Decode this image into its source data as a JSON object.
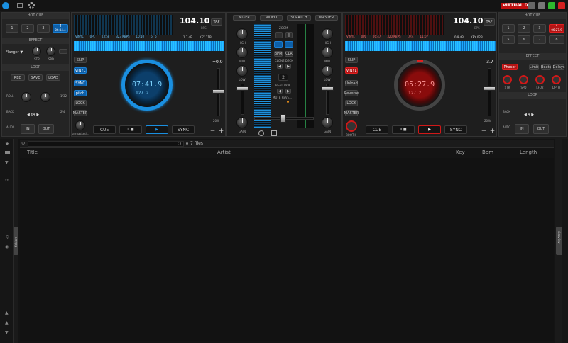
{
  "app": {
    "brand": "VIRTUAL DJ"
  },
  "left": {
    "hotcue_header": "HOT CUE",
    "hotcues": [
      "1",
      "2",
      "3",
      "4"
    ],
    "hotcue_time": "06:34.4",
    "effect_header": "EFFECT",
    "effect_name": "Flanger",
    "effect_knobs": [
      "STR",
      "SPD"
    ],
    "loop_header": "LOOP",
    "loop_buttons": [
      "RED",
      "SAVE",
      "LOAD"
    ],
    "loop_size": "64",
    "roll_label": "ROLL",
    "back_label": "BACK",
    "auto_label": "AUTO",
    "in_label": "IN",
    "out_label": "OUT",
    "side_small": [
      "1/32",
      "1/2",
      "2/4"
    ]
  },
  "deck1": {
    "bpm": "104.10",
    "bpm_unit": "BPS",
    "tap": "TAP",
    "gain_db": "1.7 dB",
    "key": "KEY 11B",
    "info_row": [
      "VINYL",
      "0PL",
      "03:58",
      "323 KBPS",
      "10:10",
      "6:_b"
    ],
    "side_buttons": [
      "SLIP",
      "VINYL",
      "SYNC",
      "pitch",
      "LOCK",
      "MASTER"
    ],
    "active_side": [
      "VINYL",
      "SYNC",
      "pitch"
    ],
    "platter_time": "07:41.9",
    "platter_sub": "127.2",
    "pitch_value": "+0.0",
    "pitch_range": "20%",
    "transport": [
      "CUE",
      "II ■",
      "▶",
      "SYNC"
    ],
    "minus": "−",
    "plus": "+",
    "encoder_label": "unmasked..."
  },
  "deck2": {
    "bpm": "104.10",
    "bpm_unit": "BPS",
    "tap": "TAP",
    "gain_db": "0.9 dB",
    "key": "KEY 02B",
    "info_row": [
      "VINYL",
      "0PL",
      "06:47",
      "320 KBPS",
      "10:4",
      "11:07"
    ],
    "side_buttons": [
      "SLIP",
      "VINYL",
      "Unload",
      "Reverse",
      "LOCK",
      "MASTER"
    ],
    "platter_time": "05:27.9",
    "platter_sub": "127.2",
    "pitch_value": "-3.7",
    "pitch_range": "20%",
    "transport": [
      "CUE",
      "II ■",
      "▶",
      "SYNC"
    ],
    "minus": "−",
    "plus": "+",
    "booth": "BOOTH"
  },
  "right": {
    "hotcue_header": "HOT CUE",
    "hotcues": [
      "1",
      "2",
      "3",
      "4",
      "5",
      "6",
      "7",
      "8"
    ],
    "hotcue_time": "06:27.9",
    "effect_header": "EFFECT",
    "effect_name": "Phaser",
    "effect_buttons": [
      "Limit",
      "Beats",
      "Delays"
    ],
    "effect_knobs": [
      "STR",
      "SPD",
      "LFO2",
      "DPTH"
    ],
    "loop_header": "LOOP",
    "loop_size": "4",
    "back_label": "BACK",
    "auto_label": "AUTO",
    "in_label": "IN",
    "out_label": "OUT"
  },
  "mixer": {
    "tabs": [
      "MIXER",
      "VIDEO",
      "SCRATCH",
      "MASTER"
    ],
    "zoom_label": "ZOOM",
    "clone_label": "CLONE DECK",
    "mini_buttons": [
      "BPM",
      "CLR"
    ],
    "beat_count": "2",
    "beatlock_label": "BEATLOCK",
    "mute_label": "MUTE REVE...",
    "eq_labels": [
      "HIGH",
      "MID",
      "LOW",
      "GAIN"
    ]
  },
  "browser": {
    "search_placeholder": "",
    "file_count": "7 files",
    "columns": [
      "Title",
      "Artist",
      "Key",
      "Bpm",
      "Length"
    ],
    "left_tab": "folders",
    "right_tab": "sideview"
  },
  "colors": {
    "accent_blue": "#1a8fe0",
    "accent_red": "#d01818",
    "waveform_blue": "#1ea7ff"
  }
}
